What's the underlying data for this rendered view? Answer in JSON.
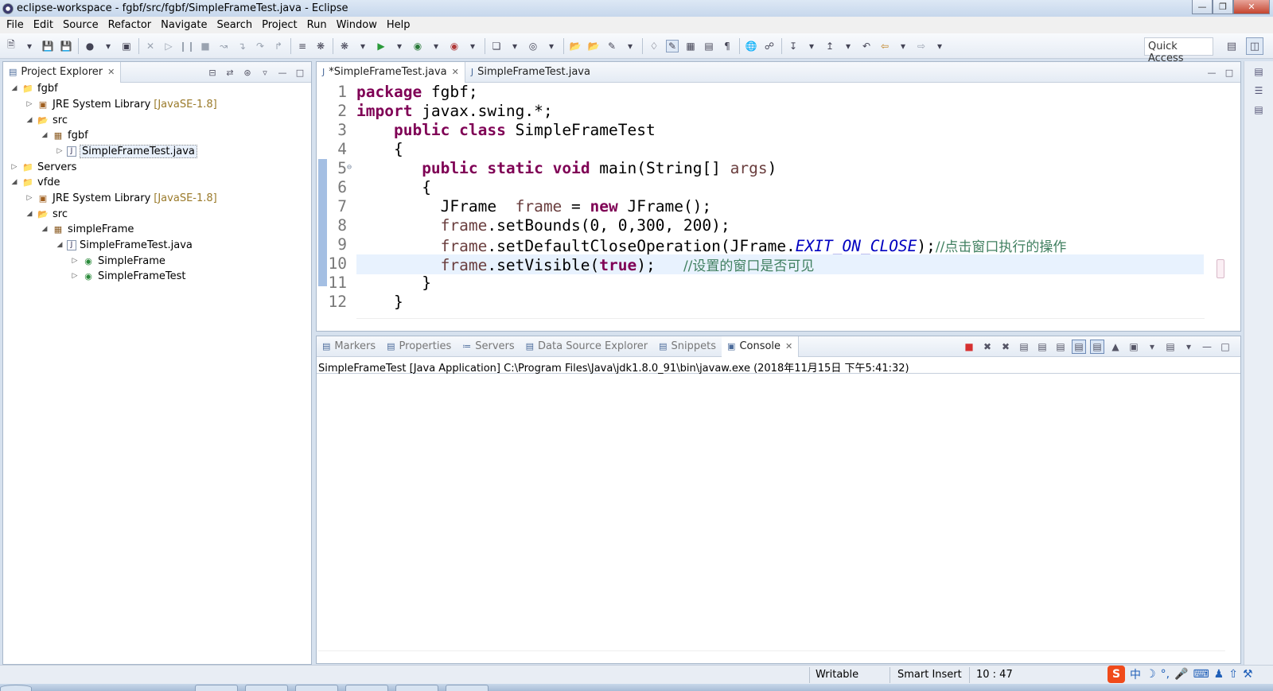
{
  "window": {
    "title": "eclipse-workspace - fgbf/src/fgbf/SimpleFrameTest.java - Eclipse"
  },
  "menu": [
    "File",
    "Edit",
    "Source",
    "Refactor",
    "Navigate",
    "Search",
    "Project",
    "Run",
    "Window",
    "Help"
  ],
  "toolbar": {
    "quick_access": "Quick Access"
  },
  "explorer": {
    "tab_label": "Project Explorer",
    "tree": [
      {
        "label": "fgbf",
        "tag": ""
      },
      {
        "label": "JRE System Library",
        "tag": "[JavaSE-1.8]"
      },
      {
        "label": "src",
        "tag": ""
      },
      {
        "label": "fgbf",
        "tag": ""
      },
      {
        "label": "SimpleFrameTest.java",
        "tag": ""
      },
      {
        "label": "Servers",
        "tag": ""
      },
      {
        "label": "vfde",
        "tag": ""
      },
      {
        "label": "JRE System Library",
        "tag": "[JavaSE-1.8]"
      },
      {
        "label": "src",
        "tag": ""
      },
      {
        "label": "simpleFrame",
        "tag": ""
      },
      {
        "label": "SimpleFrameTest.java",
        "tag": ""
      },
      {
        "label": "SimpleFrame",
        "tag": ""
      },
      {
        "label": "SimpleFrameTest",
        "tag": ""
      }
    ]
  },
  "editor": {
    "tabs": [
      {
        "label": "*SimpleFrameTest.java"
      },
      {
        "label": "SimpleFrameTest.java"
      }
    ],
    "line_numbers": [
      "1",
      "2",
      "3",
      "4",
      "5",
      "6",
      "7",
      "8",
      "9",
      "10",
      "11",
      "12"
    ],
    "code": {
      "l1_kw": "package",
      "l1_rest": " fgbf;",
      "l2_kw": "import",
      "l2_rest": " javax.swing.*;",
      "l3_kw1": "public",
      "l3_kw2": "class",
      "l3_rest": " SimpleFrameTest",
      "l4": "{",
      "l5_kw1": "public",
      "l5_kw2": "static",
      "l5_kw3": "void",
      "l5_mid": " main(String[] ",
      "l5_var": "args",
      "l5_end": ")",
      "l6": "{",
      "l7_a": "JFrame  ",
      "l7_var": "frame",
      "l7_b": " = ",
      "l7_kw": "new",
      "l7_c": " JFrame();",
      "l8_var": "frame",
      "l8_rest": ".setBounds(0, 0,300, 200);",
      "l9_var": "frame",
      "l9_a": ".setDefaultCloseOperation(JFrame.",
      "l9_fld": "EXIT_ON_CLOSE",
      "l9_b": ");",
      "l9_cmt": "//点击窗口执行的操作",
      "l10_var": "frame",
      "l10_a": ".setVisible(",
      "l10_kw": "true",
      "l10_b": ");   ",
      "l10_cmt": "//设置的窗口是否可见",
      "l11": "}",
      "l12": "}"
    }
  },
  "bottom_panel": {
    "tabs": [
      "Markers",
      "Properties",
      "Servers",
      "Data Source Explorer",
      "Snippets",
      "Console"
    ],
    "console_label": "SimpleFrameTest [Java Application] C:\\Program Files\\Java\\jdk1.8.0_91\\bin\\javaw.exe (2018年11月15日 下午5:41:32)"
  },
  "status": {
    "writable": "Writable",
    "insert_mode": "Smart Insert",
    "position": "10 : 47"
  },
  "ime": {
    "logo": "S",
    "lang": "中"
  },
  "colors": {
    "keyword": "#7f0055",
    "comment": "#3f7f5f",
    "field": "#0000c0",
    "current_line": "#e8f2fe"
  }
}
